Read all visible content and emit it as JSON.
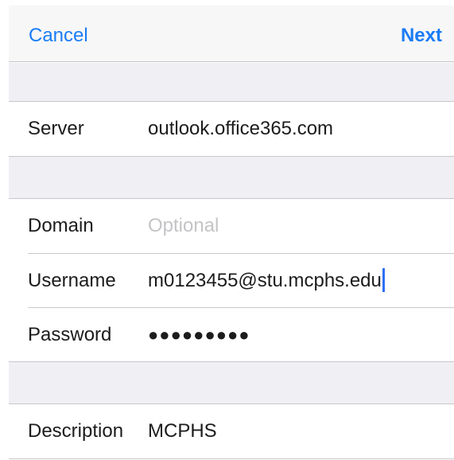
{
  "navbar": {
    "cancel_label": "Cancel",
    "next_label": "Next"
  },
  "fields": {
    "server": {
      "label": "Server",
      "value": "outlook.office365.com"
    },
    "domain": {
      "label": "Domain",
      "placeholder": "Optional"
    },
    "username": {
      "label": "Username",
      "value": "m0123455@stu.mcphs.edu"
    },
    "password": {
      "label": "Password",
      "masked_value": "●●●●●●●●●"
    },
    "description": {
      "label": "Description",
      "value": "MCPHS"
    }
  },
  "colors": {
    "accent": "#1a7cf5",
    "group_background": "#efeff4",
    "separator": "#c8c7cc",
    "placeholder_text": "#c4c4c7",
    "caret": "#2f6ff1"
  }
}
